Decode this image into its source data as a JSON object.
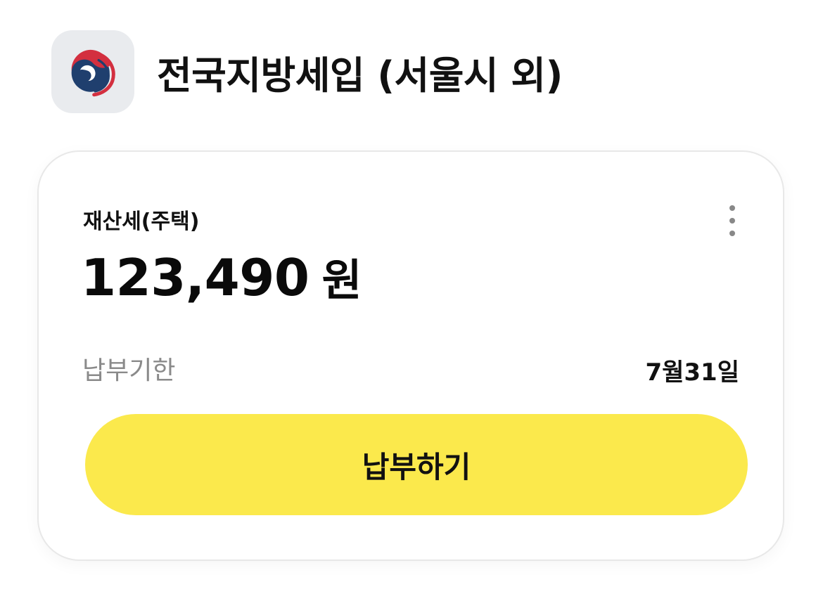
{
  "header": {
    "app_icon": "korea-government-emblem-icon",
    "title": "전국지방세입 (서울시 외)"
  },
  "card": {
    "tax_type": "재산세(주택)",
    "more_icon": "more-vertical-icon",
    "amount": "123,490",
    "currency": "원",
    "due_label": "납부기한",
    "due_date": "7월31일",
    "pay_button_label": "납부하기"
  },
  "colors": {
    "pay_button": "#fbe94c",
    "emblem_red": "#d32f3f",
    "emblem_blue": "#1f3f6e",
    "icon_background": "#e9ebee"
  }
}
